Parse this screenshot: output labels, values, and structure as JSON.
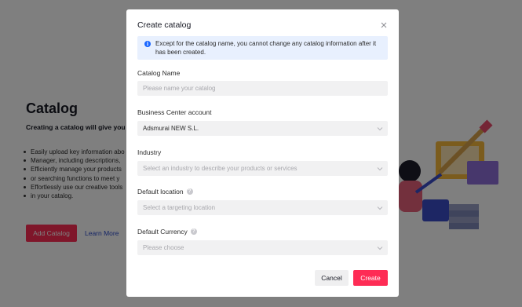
{
  "background": {
    "title": "Catalog",
    "subtitle": "Creating a catalog will give you th",
    "bullets": [
      "Easily upload key information abo",
      "Manager, including descriptions,",
      "Efficiently manage your products",
      "or searching functions to meet y",
      "Effortlessly use our creative tools",
      "in your catalog."
    ],
    "add_button": "Add Catalog",
    "learn_more": "Learn More"
  },
  "modal": {
    "title": "Create catalog",
    "info_text": "Except for the catalog name, you cannot change any catalog information after it has been created.",
    "fields": {
      "catalog_name": {
        "label": "Catalog Name",
        "placeholder": "Please name your catalog"
      },
      "business_center": {
        "label": "Business Center account",
        "value": "Adsmurai NEW S.L."
      },
      "industry": {
        "label": "Industry",
        "placeholder": "Select an industry to describe your products or services"
      },
      "default_location": {
        "label": "Default location",
        "placeholder": "Select a targeting location"
      },
      "default_currency": {
        "label": "Default Currency",
        "placeholder": "Please choose"
      }
    },
    "cancel_label": "Cancel",
    "create_label": "Create"
  },
  "colors": {
    "accent": "#fe2c55",
    "info_bg": "#e8f0fe",
    "info_icon": "#1966ff",
    "field_bg": "#f1f1f2",
    "overlay": "rgba(0,0,0,0.5)"
  },
  "icons": [
    "close-icon",
    "info-icon",
    "help-icon",
    "chevron-down-icon"
  ]
}
